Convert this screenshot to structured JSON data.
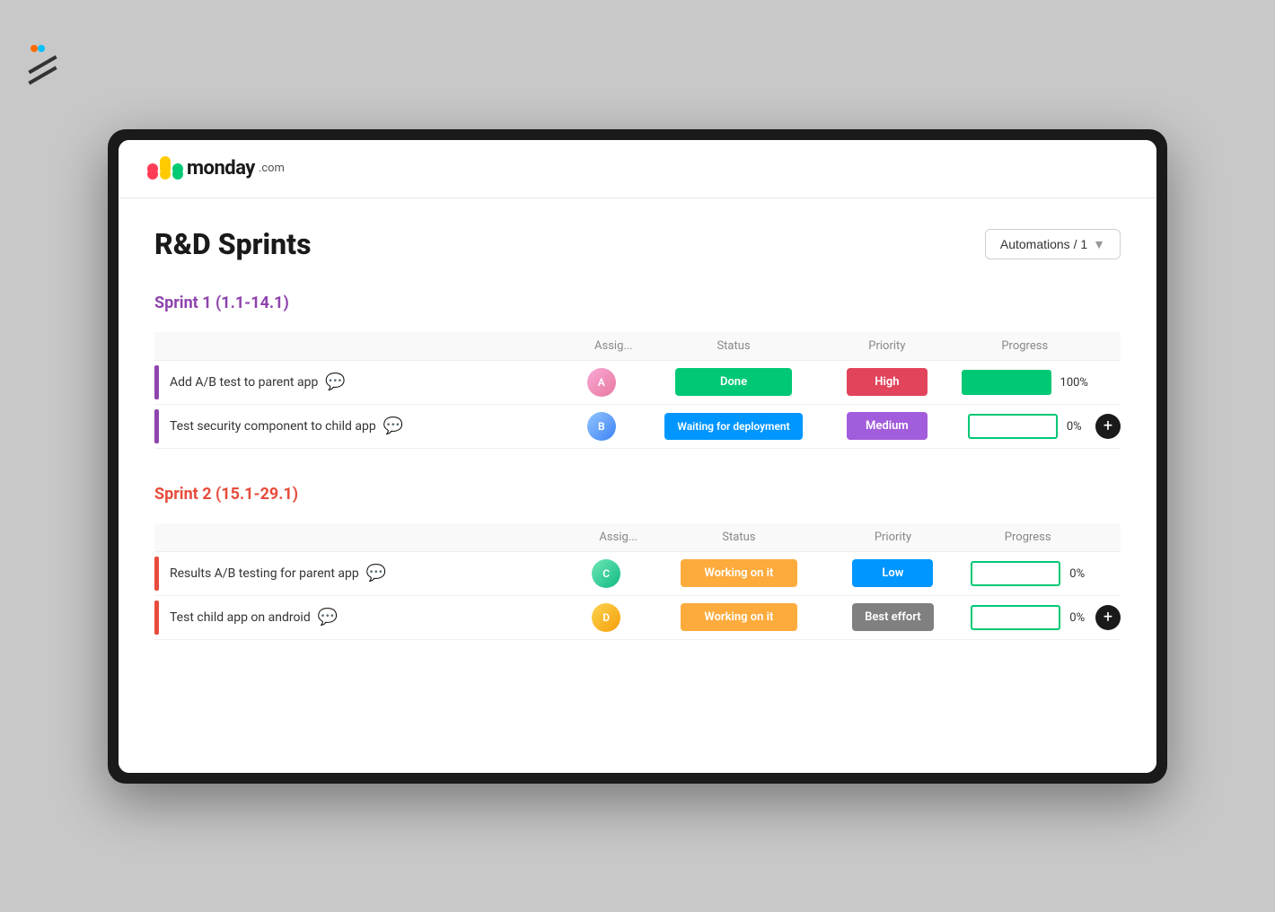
{
  "app": {
    "logo_brand": "monday",
    "logo_suffix": ".com",
    "page_title": "R&D Sprints",
    "automations_label": "Automations / 1"
  },
  "sprint1": {
    "title": "Sprint 1 (1.1-14.1)",
    "color": "purple",
    "columns": {
      "assign": "Assig...",
      "status": "Status",
      "priority": "Priority",
      "progress": "Progress"
    },
    "tasks": [
      {
        "name": "Add A/B test to parent app",
        "status": "Done",
        "status_class": "status-done",
        "priority": "High",
        "priority_class": "priority-high",
        "progress": 100,
        "avatar_class": "avatar-f",
        "avatar_initials": "A"
      },
      {
        "name": "Test security component to child app",
        "status": "Waiting for deployment",
        "status_class": "status-waiting",
        "priority": "Medium",
        "priority_class": "priority-medium",
        "progress": 0,
        "avatar_class": "avatar-m",
        "avatar_initials": "B"
      }
    ]
  },
  "sprint2": {
    "title": "Sprint 2 (15.1-29.1)",
    "color": "red",
    "columns": {
      "assign": "Assig...",
      "status": "Status",
      "priority": "Priority",
      "progress": "Progress"
    },
    "tasks": [
      {
        "name": "Results A/B testing for parent app",
        "status": "Working on it",
        "status_class": "status-working",
        "priority": "Low",
        "priority_class": "priority-low",
        "progress": 0,
        "avatar_class": "avatar-m2",
        "avatar_initials": "C"
      },
      {
        "name": "Test child app on android",
        "status": "Working on it",
        "status_class": "status-working",
        "priority": "Best effort",
        "priority_class": "priority-best",
        "progress": 0,
        "avatar_class": "avatar-m3",
        "avatar_initials": "D"
      }
    ]
  }
}
